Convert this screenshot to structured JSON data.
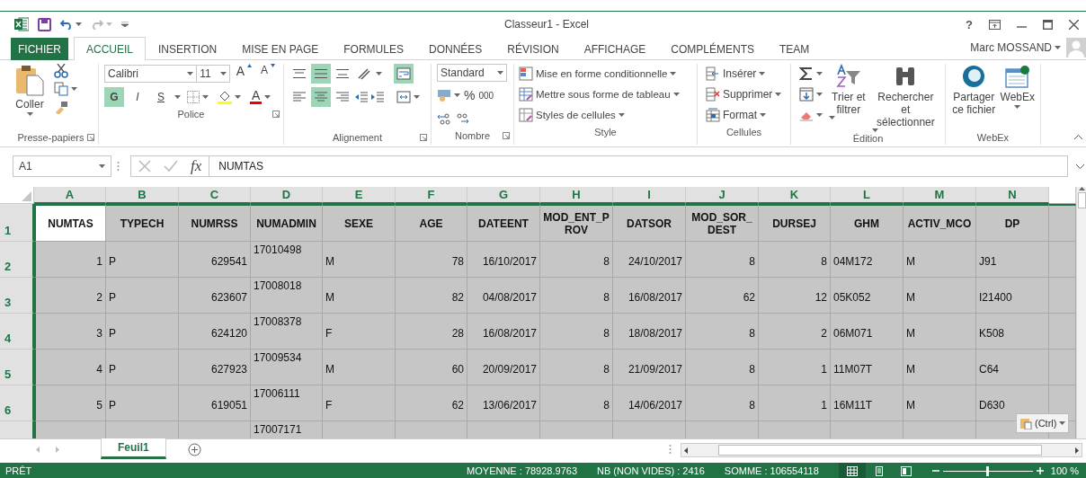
{
  "window": {
    "title": "Classeur1 - Excel",
    "help": "?"
  },
  "tabs": [
    {
      "label": "FICHIER",
      "kind": "file",
      "selected": false
    },
    {
      "label": "ACCUEIL",
      "kind": "tab",
      "selected": true
    },
    {
      "label": "INSERTION",
      "kind": "tab",
      "selected": false
    },
    {
      "label": "MISE EN PAGE",
      "kind": "tab",
      "selected": false
    },
    {
      "label": "FORMULES",
      "kind": "tab",
      "selected": false
    },
    {
      "label": "DONNÉES",
      "kind": "tab",
      "selected": false
    },
    {
      "label": "RÉVISION",
      "kind": "tab",
      "selected": false
    },
    {
      "label": "AFFICHAGE",
      "kind": "tab",
      "selected": false
    },
    {
      "label": "COMPLÉMENTS",
      "kind": "tab",
      "selected": false
    },
    {
      "label": "TEAM",
      "kind": "tab",
      "selected": false
    }
  ],
  "account": {
    "user": "Marc MOSSAND"
  },
  "ribbon": [
    {
      "kind": "clipboard",
      "label": "Presse-papiers",
      "paste": "Coller"
    },
    {
      "kind": "font",
      "label": "Police",
      "font_name": "Calibri",
      "font_size": "11",
      "grow": "A",
      "shrink": "A",
      "styles": [
        {
          "label": "G",
          "selected": true
        },
        {
          "label": "I",
          "selected": false
        },
        {
          "label": "S",
          "selected": false
        }
      ],
      "font_color": "A"
    },
    {
      "kind": "alignment",
      "label": "Alignement",
      "vertical": [
        {
          "selected": false
        },
        {
          "selected": true
        },
        {
          "selected": false
        }
      ],
      "horizontal": [
        {
          "selected": false
        },
        {
          "selected": true
        },
        {
          "selected": false
        }
      ],
      "wrap": {
        "selected": true
      }
    },
    {
      "kind": "number",
      "label": "Nombre",
      "format": "Standard",
      "percent": "%",
      "thousands": "000"
    },
    {
      "kind": "style",
      "label": "Style",
      "items": [
        "Mise en forme conditionnelle",
        "Mettre sous forme de tableau",
        "Styles de cellules"
      ]
    },
    {
      "kind": "cells",
      "label": "Cellules",
      "items": [
        "Insérer",
        "Supprimer",
        "Format"
      ]
    },
    {
      "kind": "editing",
      "label": "Édition",
      "sort": "Trier et filtrer",
      "find": "Rechercher et sélectionner"
    },
    {
      "kind": "webex",
      "label": "WebEx",
      "share": "Partager ce fichier",
      "webex": "WebEx"
    }
  ],
  "formula_bar": {
    "name_box": "A1",
    "fx": "fx",
    "value": "NUMTAS"
  },
  "grid": {
    "columns": [
      {
        "letter": "A",
        "kind": "number",
        "selected": true,
        "active": true
      },
      {
        "letter": "B",
        "kind": "text",
        "selected": true,
        "active": false
      },
      {
        "letter": "C",
        "kind": "number",
        "selected": true,
        "active": false
      },
      {
        "letter": "D",
        "kind": "top",
        "selected": true,
        "active": false
      },
      {
        "letter": "E",
        "kind": "text",
        "selected": true,
        "active": false
      },
      {
        "letter": "F",
        "kind": "number",
        "selected": true,
        "active": false
      },
      {
        "letter": "G",
        "kind": "number",
        "selected": true,
        "active": false
      },
      {
        "letter": "H",
        "kind": "number",
        "selected": true,
        "active": false
      },
      {
        "letter": "I",
        "kind": "number",
        "selected": true,
        "active": false
      },
      {
        "letter": "J",
        "kind": "number",
        "selected": true,
        "active": false
      },
      {
        "letter": "K",
        "kind": "number",
        "selected": true,
        "active": false
      },
      {
        "letter": "L",
        "kind": "text",
        "selected": true,
        "active": false
      },
      {
        "letter": "M",
        "kind": "text",
        "selected": true,
        "active": false
      },
      {
        "letter": "N",
        "kind": "text",
        "selected": true,
        "active": false
      }
    ],
    "rows": [
      {
        "number": "1",
        "kind": "header",
        "selected": true,
        "active": true,
        "cells": [
          "NUMTAS",
          "TYPECH",
          "NUMRSS",
          "NUMADMIN",
          "SEXE",
          "AGE",
          "DATEENT",
          "MOD_ENT_PROV",
          "DATSOR",
          "MOD_SOR_DEST",
          "DURSEJ",
          "GHM",
          "ACTIV_MCO",
          "DP"
        ]
      },
      {
        "number": "2",
        "kind": "data",
        "selected": true,
        "active": false,
        "cells": [
          "1",
          "P",
          "629541",
          "17010498",
          "M",
          "78",
          "16/10/2017",
          "8",
          "24/10/2017",
          "8",
          "8",
          "04M172",
          "M",
          "J91"
        ]
      },
      {
        "number": "3",
        "kind": "data",
        "selected": true,
        "active": false,
        "cells": [
          "2",
          "P",
          "623607",
          "17008018",
          "M",
          "82",
          "04/08/2017",
          "8",
          "16/08/2017",
          "62",
          "12",
          "05K052",
          "M",
          "I21400"
        ]
      },
      {
        "number": "4",
        "kind": "data",
        "selected": true,
        "active": false,
        "cells": [
          "3",
          "P",
          "624120",
          "17008378",
          "F",
          "28",
          "16/08/2017",
          "8",
          "18/08/2017",
          "8",
          "2",
          "06M071",
          "M",
          "K508"
        ]
      },
      {
        "number": "5",
        "kind": "data",
        "selected": true,
        "active": false,
        "cells": [
          "4",
          "P",
          "627923",
          "17009534",
          "M",
          "60",
          "20/09/2017",
          "8",
          "21/09/2017",
          "8",
          "1",
          "11M07T",
          "M",
          "C64"
        ]
      },
      {
        "number": "6",
        "kind": "data",
        "selected": true,
        "active": false,
        "cells": [
          "5",
          "P",
          "619051",
          "17006111",
          "F",
          "62",
          "13/06/2017",
          "8",
          "14/06/2017",
          "8",
          "1",
          "16M11T",
          "M",
          "D630"
        ]
      },
      {
        "kind": "data",
        "selected": true,
        "active": false,
        "cells": [
          null,
          null,
          null,
          "17007171",
          null,
          null,
          null,
          null,
          null,
          null,
          null,
          null,
          null,
          null
        ]
      }
    ],
    "paste_options": {
      "label": "(Ctrl)"
    }
  },
  "sheets": [
    {
      "label": "Feuil1",
      "selected": true
    }
  ],
  "status_bar": {
    "mode": "PRÊT",
    "stats": [
      "MOYENNE : 78928.9763",
      "NB (NON VIDES) : 2416",
      "SOMME : 106554118"
    ],
    "views": [
      {
        "kind": "normal",
        "selected": true
      },
      {
        "kind": "page_layout",
        "selected": false
      },
      {
        "kind": "page_break",
        "selected": false
      }
    ],
    "zoom": {
      "level": 0.5,
      "label": "100 %"
    }
  }
}
